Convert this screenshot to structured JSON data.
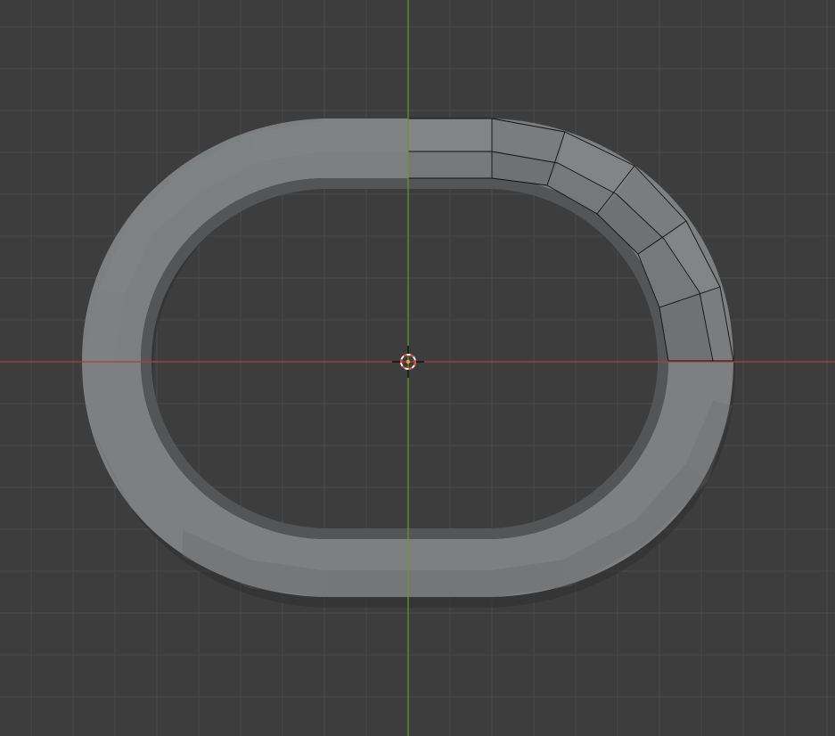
{
  "viewport": {
    "background_color": "#3d3d3d",
    "grid_line_color": "#4a4a4a",
    "x_axis_color": "#b33b4b",
    "y_axis_color": "#6c9a1e"
  },
  "mesh": {
    "object_shape": "rounded-rectangle-ring",
    "face_color": "#7d7f80",
    "face_light_color": "#878a8b",
    "face_dark_color": "#666869",
    "inner_wall_color": "#545556",
    "shadow_color": "#2f2f2f",
    "edge_color": "#111111",
    "selected_region": "upper-right-quarter"
  },
  "cursor_3d": {
    "icon": "3d-cursor-icon",
    "ring_color_a": "#ffffff",
    "ring_color_b": "#e04a36",
    "center_color": "#f0a020"
  }
}
